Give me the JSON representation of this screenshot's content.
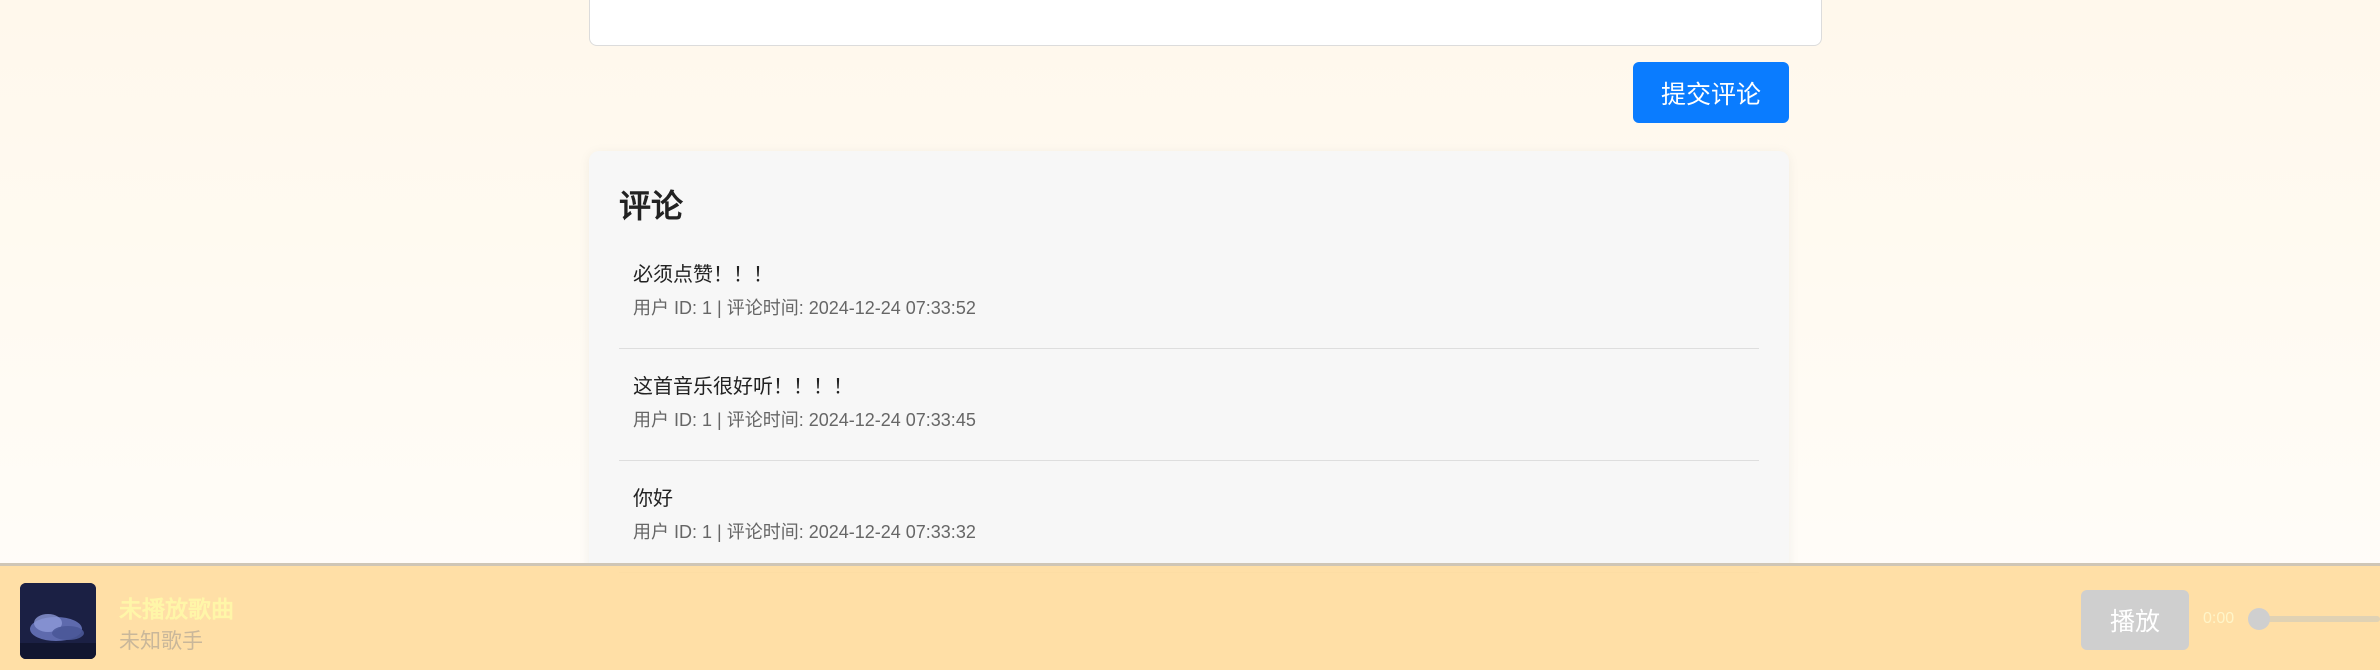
{
  "comment_form": {
    "submit_label": "提交评论"
  },
  "comments": {
    "title": "评论",
    "items": [
      {
        "text": "必须点赞！！！",
        "meta": "用户 ID: 1 | 评论时间: 2024-12-24 07:33:52"
      },
      {
        "text": "这首音乐很好听！！！！",
        "meta": "用户 ID: 1 | 评论时间: 2024-12-24 07:33:45"
      },
      {
        "text": "你好",
        "meta": "用户 ID: 1 | 评论时间: 2024-12-24 07:33:32"
      }
    ]
  },
  "player": {
    "song_title": "未播放歌曲",
    "artist": "未知歌手",
    "play_label": "播放",
    "current_time": "0:00",
    "progress": 0,
    "cover_icon": "album-cover"
  },
  "colors": {
    "accent": "#0a7cff",
    "player_bg": "#ffdda0"
  }
}
